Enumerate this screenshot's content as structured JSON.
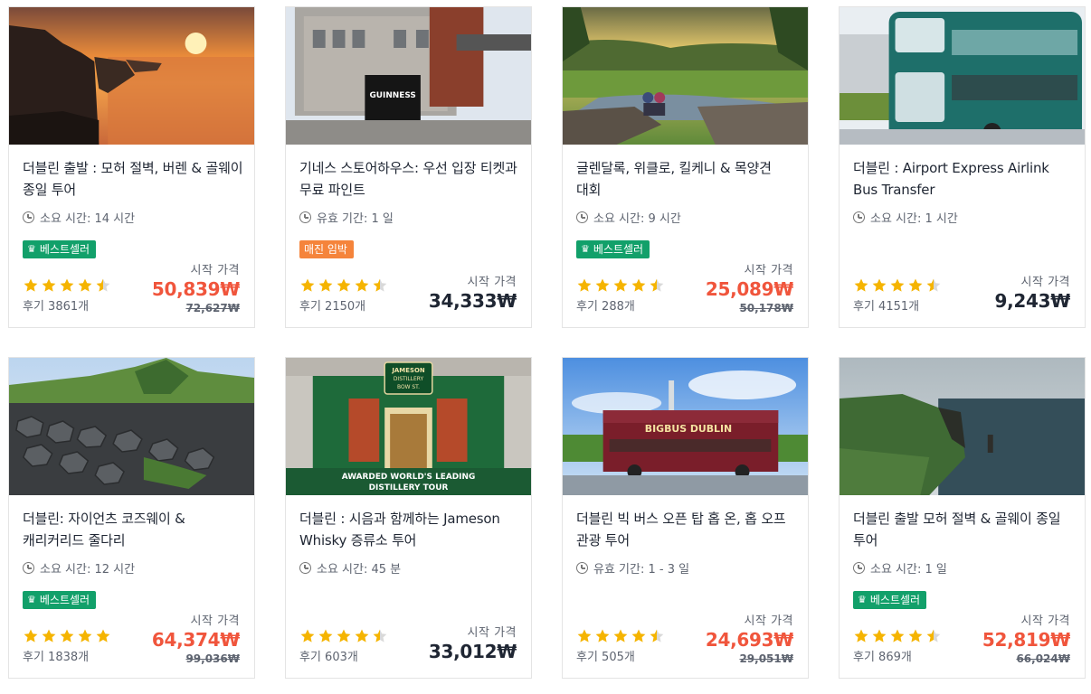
{
  "labels": {
    "from": "시작 가격"
  },
  "colors": {
    "sale": "#f0553c",
    "bestseller": "#12a06a",
    "soldout_soon": "#f5843b",
    "star": "#f5b400"
  },
  "cards": [
    {
      "title": "더블린 출발 : 모허 절벽, 버렌 & 골웨이 종일 투어",
      "meta": "소요 시간: 14 시간",
      "badge": "베스트셀러",
      "badge_type": "green",
      "badge_icon": "crown-icon",
      "rating": 4.5,
      "reviews": "후기 3861개",
      "price": "50,839₩",
      "old_price": "72,627₩",
      "image": "cliffs-sunset"
    },
    {
      "title": "기네스 스토어하우스: 우선 입장 티켓과 무료 파인트",
      "meta": "유효 기간: 1 일",
      "badge": "매진 임박",
      "badge_type": "orange",
      "badge_icon": "",
      "rating": 4.5,
      "reviews": "후기 2150개",
      "price": "34,333₩",
      "old_price": "",
      "image": "guinness-brewery"
    },
    {
      "title": "글렌달록, 위클로, 킬케니 & 목양견 대회",
      "meta": "소요 시간: 9 시간",
      "badge": "베스트셀러",
      "badge_type": "green",
      "badge_icon": "crown-icon",
      "rating": 4.5,
      "reviews": "후기 288개",
      "price": "25,089₩",
      "old_price": "50,178₩",
      "image": "glendalough"
    },
    {
      "title": "더블린 : Airport Express Airlink Bus Transfer",
      "meta": "소요 시간: 1 시간",
      "badge": "",
      "badge_type": "",
      "badge_icon": "",
      "rating": 4.5,
      "reviews": "후기 4151개",
      "price": "9,243₩",
      "old_price": "",
      "image": "airlink-bus"
    },
    {
      "title": "더블린: 자이언츠 코즈웨이 & 캐리커리드 줄다리",
      "meta": "소요 시간: 12 시간",
      "badge": "베스트셀러",
      "badge_type": "green",
      "badge_icon": "crown-icon",
      "rating": 5,
      "reviews": "후기 1838개",
      "price": "64,374₩",
      "old_price": "99,036₩",
      "image": "giants-causeway"
    },
    {
      "title": "더블린 : 시음과 함께하는 Jameson Whisky 증류소 투어",
      "meta": "소요 시간: 45 분",
      "badge": "",
      "badge_type": "",
      "badge_icon": "",
      "rating": 4.5,
      "reviews": "후기 603개",
      "price": "33,012₩",
      "old_price": "",
      "image": "jameson-distillery",
      "image_text_1": "JAMESON",
      "image_text_2": "DISTILLERY",
      "image_text_3": "BOW ST.",
      "image_text_4": "AWARDED WORLD'S LEADING",
      "image_text_5": "DISTILLERY TOUR"
    },
    {
      "title": "더블린 빅 버스 오픈 탑 홉 온, 홉 오프 관광 투어",
      "meta": "유효 기간: 1 - 3 일",
      "badge": "",
      "badge_type": "",
      "badge_icon": "",
      "rating": 4.5,
      "reviews": "후기 505개",
      "price": "24,693₩",
      "old_price": "29,051₩",
      "image": "bigbus-dublin",
      "image_text_1": "BIGBUS DUBLIN"
    },
    {
      "title": "더블린 출발 모허 절벽 & 골웨이 종일 투어",
      "meta": "소요 시간: 1 일",
      "badge": "베스트셀러",
      "badge_type": "green",
      "badge_icon": "crown-icon",
      "rating": 4.5,
      "reviews": "후기 869개",
      "price": "52,819₩",
      "old_price": "66,024₩",
      "image": "cliffs-green"
    }
  ]
}
